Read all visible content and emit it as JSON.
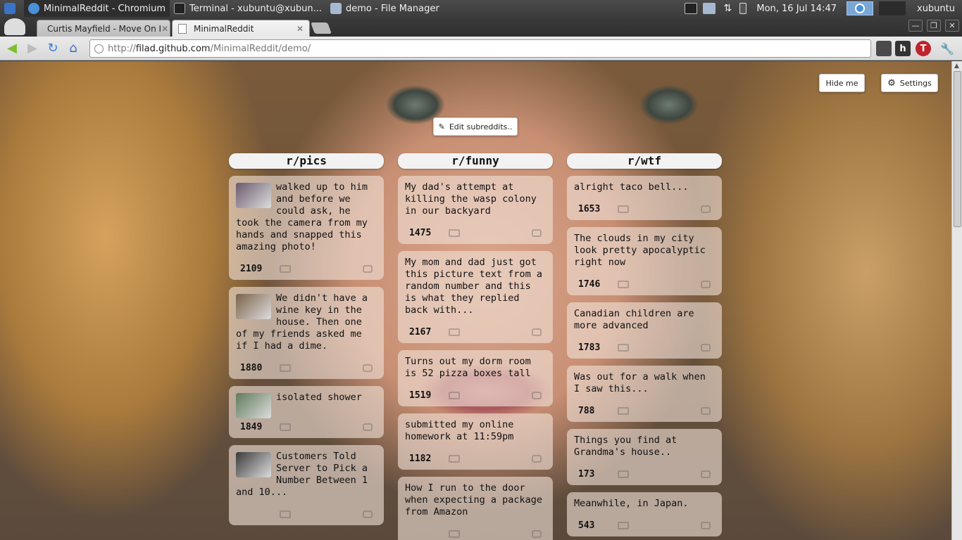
{
  "taskbar": {
    "windows": [
      {
        "label": "MinimalReddit - Chromium"
      },
      {
        "label": "Terminal - xubuntu@xubun..."
      },
      {
        "label": "demo - File Manager"
      }
    ],
    "clock": "Mon, 16 Jul  14:47",
    "user": "xubuntu"
  },
  "browser": {
    "tabs": [
      {
        "title": "Curtis Mayfield - Move On I"
      },
      {
        "title": "MinimalReddit"
      }
    ],
    "url": {
      "proto": "http://",
      "host": "filad.github.com",
      "path": "/MinimalReddit/demo/"
    },
    "extensions": [
      "h"
    ]
  },
  "page": {
    "hide_label": "Hide me",
    "settings_label": "Settings",
    "edit_label": "Edit subreddits..",
    "columns": [
      {
        "name": "r/pics",
        "posts": [
          {
            "title": "walked up to him and before we could ask, he took the camera from my hands and snapped this amazing photo!",
            "score": "2109",
            "thumb_color": "#6b5a6e"
          },
          {
            "title": "We didn't have a wine key in the house. Then one of my friends asked me if I had a dime.",
            "score": "1880",
            "thumb_color": "#7a6248"
          },
          {
            "title": "isolated shower",
            "score": "1849",
            "thumb_color": "#5f7a5a"
          },
          {
            "title": "Customers Told Server to Pick a Number Between 1 and 10...",
            "score": "",
            "thumb_color": "#3a3a3a"
          }
        ]
      },
      {
        "name": "r/funny",
        "posts": [
          {
            "title": "My dad's attempt at killing the wasp colony in our backyard",
            "score": "1475"
          },
          {
            "title": "My mom and dad just got this picture text from a random number and this is what they replied back with...",
            "score": "2167"
          },
          {
            "title": "Turns out my dorm room is 52 pizza boxes tall",
            "score": "1519"
          },
          {
            "title": "submitted my online homework at 11:59pm",
            "score": "1182"
          },
          {
            "title": "How I run to the door when expecting a package from Amazon",
            "score": ""
          }
        ]
      },
      {
        "name": "r/wtf",
        "posts": [
          {
            "title": "alright taco bell...",
            "score": "1653"
          },
          {
            "title": "The clouds in my city look pretty apocalyptic right now",
            "score": "1746"
          },
          {
            "title": "Canadian children are more advanced",
            "score": "1783"
          },
          {
            "title": "Was out for a walk when I saw this...",
            "score": "788"
          },
          {
            "title": "Things you find at Grandma's house..",
            "score": "173"
          },
          {
            "title": "Meanwhile, in Japan.",
            "score": "543"
          }
        ]
      }
    ]
  }
}
